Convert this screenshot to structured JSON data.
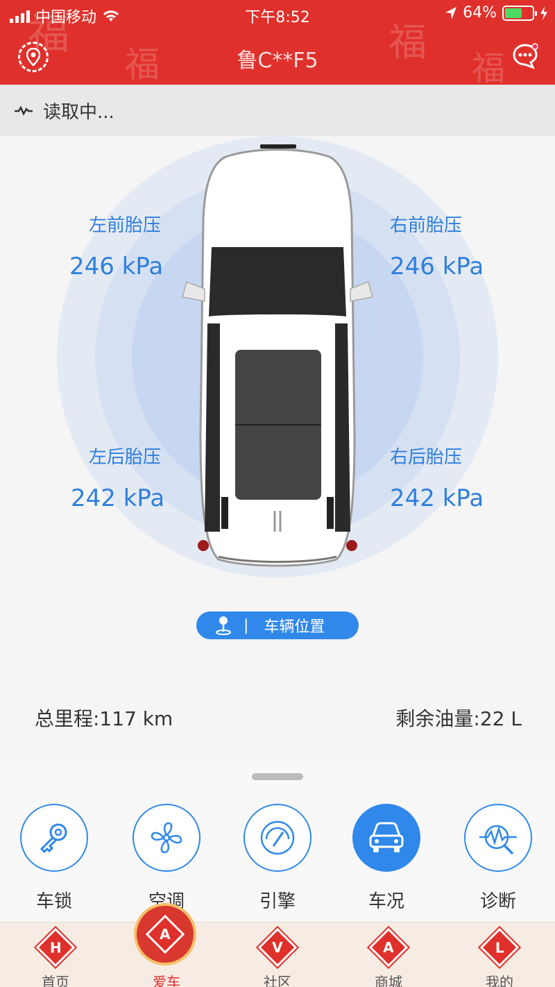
{
  "status_bar": {
    "carrier": "中国移动",
    "time": "下午8:52",
    "battery": "64%",
    "battery_level": 0.64
  },
  "nav": {
    "title": "鲁C**F5"
  },
  "reading": {
    "text": "读取中..."
  },
  "tires": {
    "front_left": {
      "label": "左前胎压",
      "value": "246 kPa"
    },
    "front_right": {
      "label": "右前胎压",
      "value": "246 kPa"
    },
    "rear_left": {
      "label": "左后胎压",
      "value": "242 kPa"
    },
    "rear_right": {
      "label": "右后胎压",
      "value": "242 kPa"
    }
  },
  "position_button": {
    "label": "车辆位置"
  },
  "stats": {
    "mileage": "总里程:117 km",
    "fuel": "剩余油量:22 L"
  },
  "functions": [
    {
      "label": "车锁",
      "icon": "key-icon"
    },
    {
      "label": "空调",
      "icon": "fan-icon"
    },
    {
      "label": "引擎",
      "icon": "gauge-icon"
    },
    {
      "label": "车况",
      "icon": "car-icon"
    },
    {
      "label": "诊断",
      "icon": "diagnose-icon"
    }
  ],
  "tabs": [
    {
      "label": "首页",
      "letter": "H"
    },
    {
      "label": "爱车",
      "letter": "A"
    },
    {
      "label": "社区",
      "letter": "V"
    },
    {
      "label": "商城",
      "letter": "A"
    },
    {
      "label": "我的",
      "letter": "L"
    }
  ],
  "colors": {
    "brand_red": "#e0302b",
    "accent_blue": "#2f88ea",
    "tire_text_blue": "#2f7fdc"
  }
}
